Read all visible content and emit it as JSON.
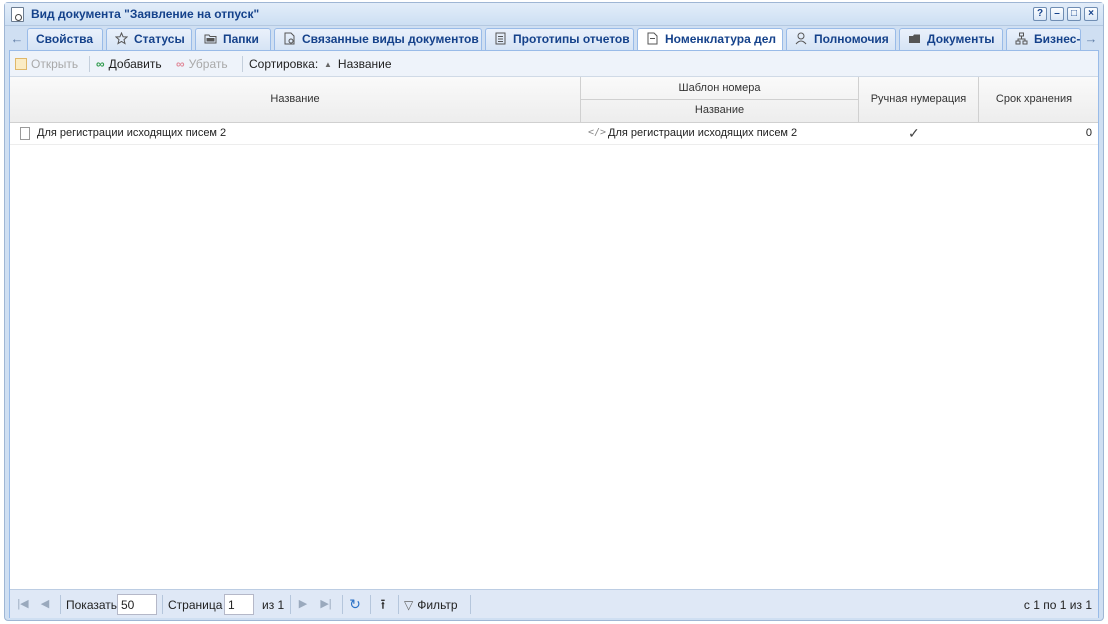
{
  "window": {
    "title": "Вид документа \"Заявление на отпуск\"",
    "buttons": [
      "?",
      "–",
      "□",
      "×"
    ]
  },
  "tabs": [
    {
      "label": "Свойства",
      "icon": "none"
    },
    {
      "label": "Статусы",
      "icon": "star-icon"
    },
    {
      "label": "Папки",
      "icon": "folder-icon"
    },
    {
      "label": "Связанные виды документов",
      "icon": "doc-link-icon"
    },
    {
      "label": "Прототипы отчетов",
      "icon": "report-icon"
    },
    {
      "label": "Номенклатура дел",
      "icon": "file-icon",
      "active": true
    },
    {
      "label": "Полномочия",
      "icon": "user-key-icon"
    },
    {
      "label": "Документы",
      "icon": "folder-doc-icon"
    },
    {
      "label": "Бизнес-",
      "icon": "org-chart-icon"
    }
  ],
  "toolbar": {
    "open_label": "Открыть",
    "add_label": "Добавить",
    "remove_label": "Убрать",
    "sort_label": "Сортировка:",
    "sort_field": "Название"
  },
  "grid": {
    "columns": {
      "name": "Название",
      "template_group": "Шаблон номера",
      "template_name": "Название",
      "manual_numbering": "Ручная нумерация",
      "retention": "Срок хранения"
    },
    "rows": [
      {
        "name": "Для регистрации исходящих писем 2",
        "template": "Для регистрации исходящих писем 2",
        "manual_numbering": "✓",
        "retention": "0"
      }
    ]
  },
  "pager": {
    "show_label": "Показать",
    "page_size": "50",
    "page_label": "Страница",
    "page_value": "1",
    "of_label": "из 1",
    "filter_label": "Фильтр",
    "summary": "с 1 по 1 из 1"
  },
  "colors": {
    "accent": "#15428b",
    "header_bg": "#cfdff2",
    "pager_bg": "#dfe8f6"
  }
}
